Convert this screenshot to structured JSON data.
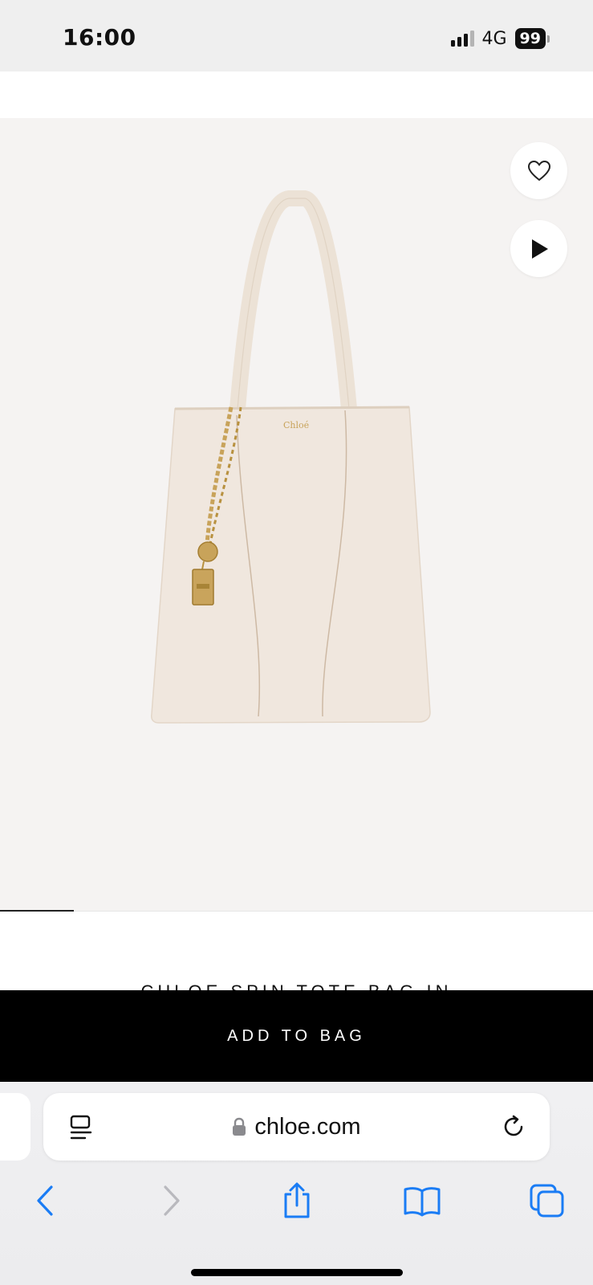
{
  "status_bar": {
    "time": "16:00",
    "network": "4G",
    "battery": "99",
    "signal_bars": 4,
    "signal_active": 3
  },
  "product": {
    "title": "CHLOÉ SPIN TOTE BAG IN",
    "brand_stamp": "Chloé",
    "add_to_bag_label": "ADD TO BAG",
    "gallery_position": 1
  },
  "browser": {
    "url": "chloe.com",
    "secure": true
  },
  "colors": {
    "status_bg": "#efefef",
    "image_bg": "#f5f3f2",
    "bag_leather": "#f0e7de",
    "hardware_gold": "#c8a35a",
    "cta_bg": "#000000",
    "safari_blue": "#1a7cf5"
  },
  "icons": {
    "wishlist": "heart-outline-icon",
    "video": "play-icon",
    "page_menu": "page-menu-icon",
    "lock": "lock-icon",
    "reload": "reload-icon",
    "back": "chevron-left-icon",
    "forward": "chevron-right-icon",
    "share": "share-icon",
    "bookmarks": "book-icon",
    "tabs": "tabs-icon"
  }
}
